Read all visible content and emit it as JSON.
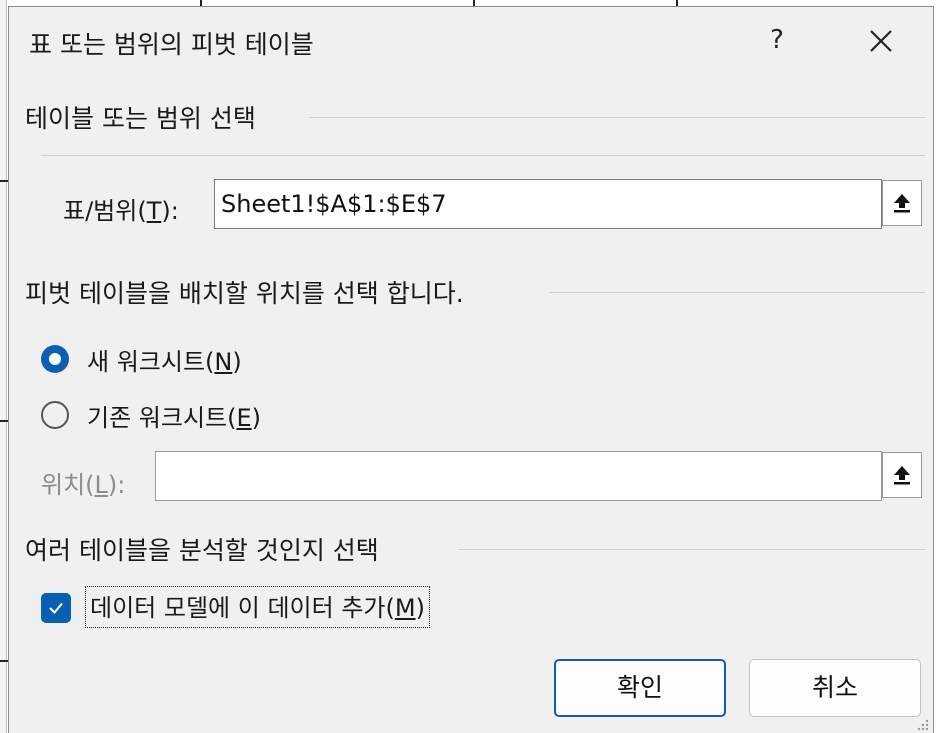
{
  "window": {
    "title": "표 또는 범위의 피벗 테이블",
    "help_label": "?",
    "close_icon": "close-icon"
  },
  "source": {
    "group_label": "테이블 또는 범위 선택",
    "range_label_prefix": "표/범위(",
    "range_label_accel": "T",
    "range_label_suffix": "):",
    "range_value": "Sheet1!$A$1:$E$7",
    "ref_icon": "collapse-dialog-icon"
  },
  "placement": {
    "group_label": "피벗 테이블을 배치할 위치를 선택 합니다.",
    "options": [
      {
        "label_prefix": "새 워크시트(",
        "accel": "N",
        "label_suffix": ")",
        "selected": true
      },
      {
        "label_prefix": "기존 워크시트(",
        "accel": "E",
        "label_suffix": ")",
        "selected": false
      }
    ],
    "location_label_prefix": "위치(",
    "location_label_accel": "L",
    "location_label_suffix": "):",
    "location_value": "",
    "ref_icon": "collapse-dialog-icon"
  },
  "analysis": {
    "group_label": "여러 테이블을 분석할 것인지 선택",
    "checkbox_label_prefix": "데이터 모델에 이 데이터 추가(",
    "checkbox_accel": "M",
    "checkbox_label_suffix": ")",
    "checked": true
  },
  "buttons": {
    "ok": "확인",
    "cancel": "취소"
  },
  "colors": {
    "accent": "#0a5fb5",
    "dialog_bg": "#f0f0f0"
  }
}
